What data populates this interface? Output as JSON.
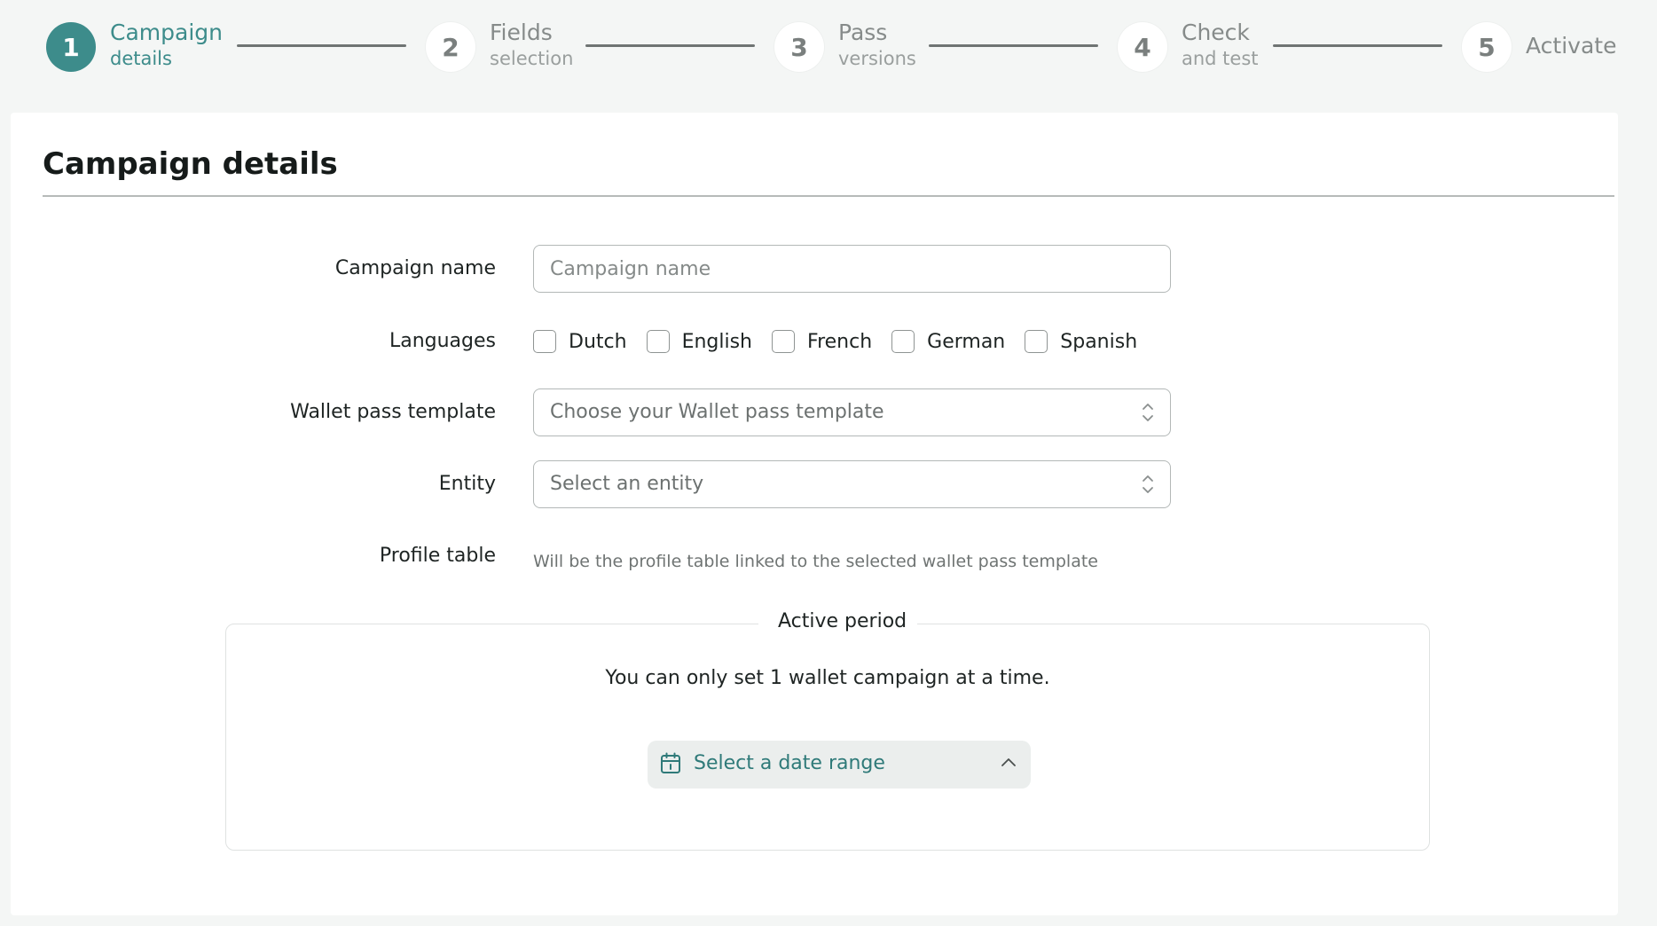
{
  "stepper": {
    "steps": [
      {
        "number": "1",
        "title": "Campaign",
        "subtitle": "details"
      },
      {
        "number": "2",
        "title": "Fields",
        "subtitle": "selection"
      },
      {
        "number": "3",
        "title": "Pass",
        "subtitle": "versions"
      },
      {
        "number": "4",
        "title": "Check",
        "subtitle": "and test"
      },
      {
        "number": "5",
        "title": "Activate",
        "subtitle": ""
      }
    ],
    "active_step": 1
  },
  "card": {
    "title": "Campaign details"
  },
  "form": {
    "campaign_name": {
      "label": "Campaign name",
      "value": "",
      "placeholder": "Campaign name"
    },
    "languages": {
      "label": "Languages",
      "options": [
        {
          "label": "Dutch",
          "checked": false
        },
        {
          "label": "English",
          "checked": false
        },
        {
          "label": "French",
          "checked": false
        },
        {
          "label": "German",
          "checked": false
        },
        {
          "label": "Spanish",
          "checked": false
        }
      ]
    },
    "wallet_template": {
      "label": "Wallet pass template",
      "placeholder": "Choose your Wallet pass template"
    },
    "entity": {
      "label": "Entity",
      "placeholder": "Select an entity"
    },
    "profile_table": {
      "label": "Profile table",
      "helper": "Will be the profile table linked to the selected wallet pass template"
    }
  },
  "active_period": {
    "legend": "Active period",
    "note": "You can only set 1 wallet campaign at a time.",
    "date_range_label": "Select a date range"
  },
  "colors": {
    "accent": "#3d8c8b",
    "background": "#f4f6f5",
    "card": "#ffffff"
  },
  "icons": {
    "date_range": "calendar-icon",
    "select_indicator": "updown-arrows-icon",
    "collapse_indicator": "chevron-up-icon"
  }
}
